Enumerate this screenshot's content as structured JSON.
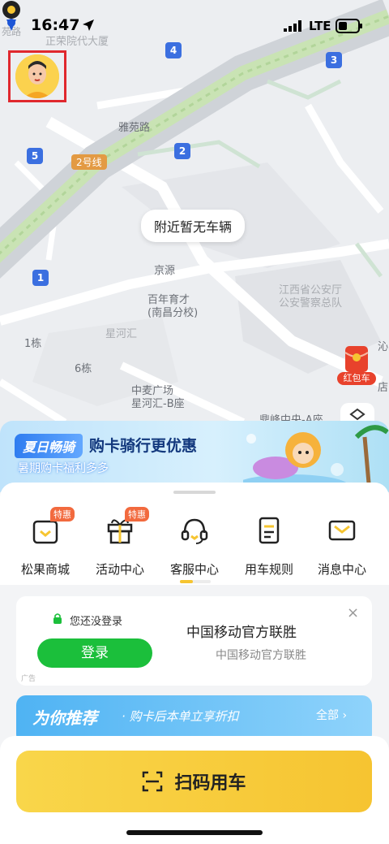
{
  "status_bar": {
    "time": "16:47",
    "network": "LTE"
  },
  "map": {
    "no_vehicle_text": "附近暂无车辆",
    "labels": {
      "road_yayuan": "雅苑路",
      "line2": "2号线",
      "jingyuan": "京源",
      "school1": "百年育才",
      "school2": "(南昌分校)",
      "xinghe": "星河汇",
      "bldg1": "1栋",
      "bldg6": "6栋",
      "zhongmai1": "中麦广场",
      "zhongmai2": "星河汇-B座",
      "police1": "江西省公安厅",
      "police2": "公安警察总队",
      "dingfeng": "鼎峰中央-A座",
      "top_left": "正荣院代大厦",
      "side_yuan": "苑路",
      "dian": "店",
      "yuan": "沁"
    },
    "route_badges": [
      "4",
      "3",
      "2",
      "5",
      "1"
    ],
    "red_packet_label": "红包车"
  },
  "promo": {
    "tag": "夏日畅骑",
    "title": "购卡骑行更优惠",
    "subtitle": "暑期购卡福利多多"
  },
  "menu": [
    {
      "label": "松果商城",
      "badge": "特惠",
      "icon": "shopping-bag-icon"
    },
    {
      "label": "活动中心",
      "badge": "特惠",
      "icon": "gift-icon"
    },
    {
      "label": "客服中心",
      "badge": "",
      "icon": "headset-icon"
    },
    {
      "label": "用车规则",
      "badge": "",
      "icon": "rules-document-icon"
    },
    {
      "label": "消息中心",
      "badge": "",
      "icon": "envelope-icon"
    }
  ],
  "ad": {
    "not_logged_in": "您还没登录",
    "login_button": "登录",
    "title": "中国移动官方联胜",
    "subtitle": "中国移动官方联胜",
    "ad_mark": "广告",
    "close": "×"
  },
  "recommend": {
    "title": "为你推荐",
    "subtitle": "· 购卡后本单立享折扣",
    "all": "全部 ›"
  },
  "scan": {
    "label": "扫码用车"
  },
  "colors": {
    "accent_yellow": "#f6c531",
    "login_green": "#1bbf3b",
    "badge_blue": "#3b6fe0"
  }
}
